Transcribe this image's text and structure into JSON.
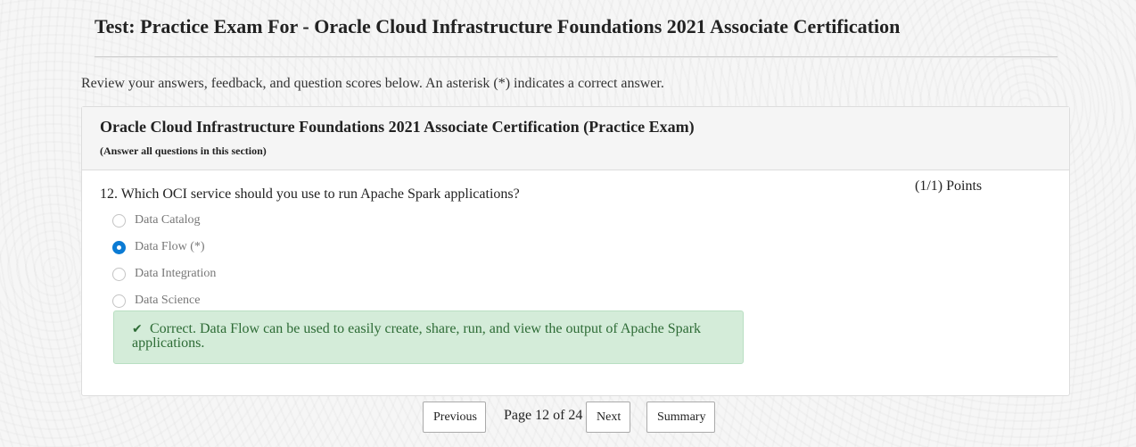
{
  "header": {
    "title": "Test: Practice Exam For - Oracle Cloud Infrastructure Foundations 2021 Associate Certification"
  },
  "instructions": "Review your answers, feedback, and question scores below. An asterisk (*) indicates a correct answer.",
  "section": {
    "title": "Oracle Cloud Infrastructure Foundations 2021 Associate Certification (Practice Exam)",
    "subtitle": "(Answer all questions in this section)"
  },
  "question": {
    "text": "12. Which OCI service should you use to run Apache Spark applications?",
    "points": "(1/1) Points",
    "options": [
      {
        "label": "Data Catalog",
        "selected": false
      },
      {
        "label": "Data Flow (*)",
        "selected": true
      },
      {
        "label": "Data Integration",
        "selected": false
      },
      {
        "label": "Data Science",
        "selected": false
      }
    ],
    "feedback": "Correct. Data Flow can be used to easily create, share, run, and view the output of Apache Spark applications.",
    "feedback_icon": "checkmark-icon",
    "accent_color": "#0b7bd4",
    "feedback_color": "#2d6b35"
  },
  "pager": {
    "previous_label": "Previous",
    "page_text": "Page 12 of 24",
    "next_label": "Next",
    "summary_label": "Summary"
  }
}
